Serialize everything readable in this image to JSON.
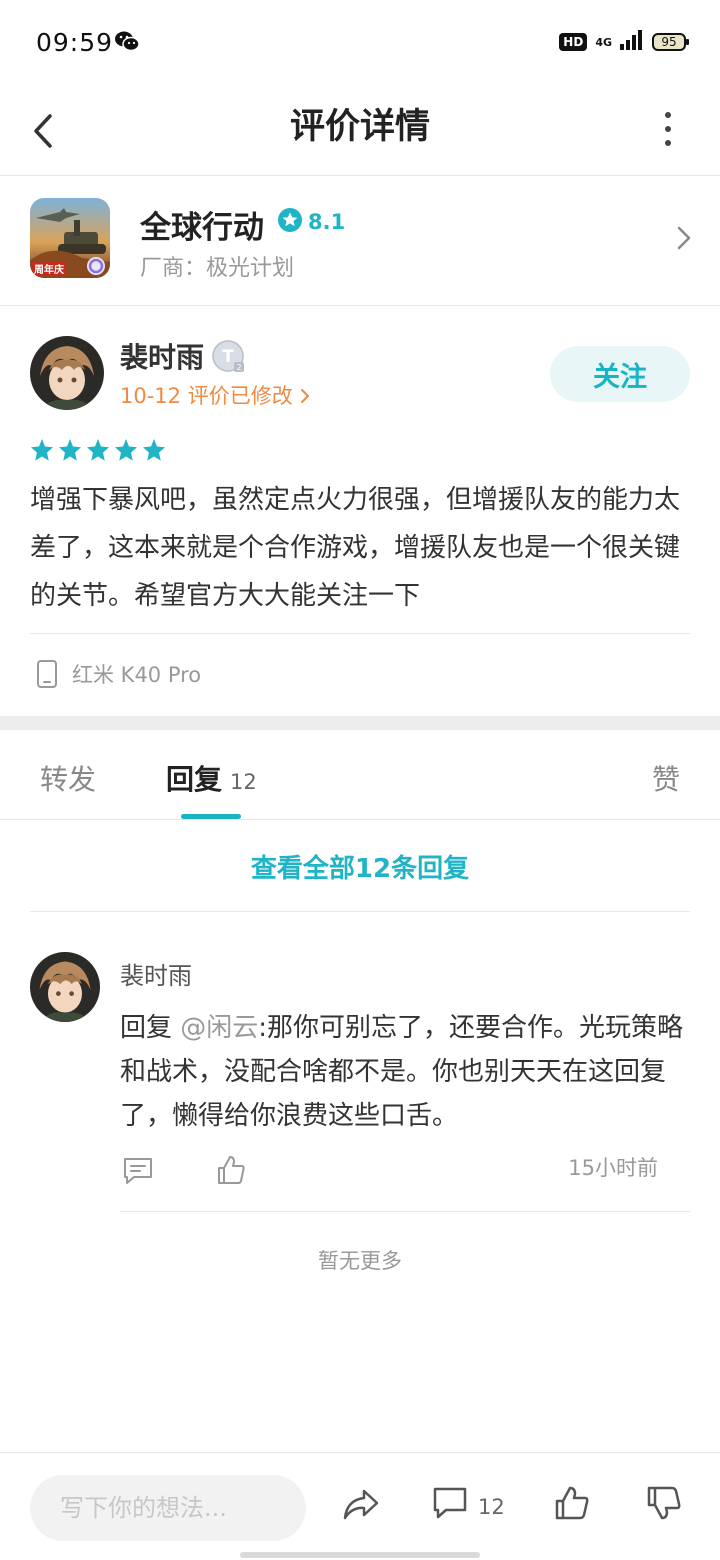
{
  "status_bar": {
    "time": "09:59",
    "hd": "HD",
    "network": "4G",
    "battery": "95"
  },
  "header": {
    "title": "评价详情"
  },
  "game": {
    "name": "全球行动",
    "rating": "8.1",
    "vendor": "厂商：极光计划"
  },
  "review": {
    "author": "裴时雨",
    "meta": "10-12 评价已修改",
    "follow_label": "关注",
    "stars": 5,
    "text": "增强下暴风吧，虽然定点火力很强，但增援队友的能力太差了，这本来就是个合作游戏，增援队友也是一个很关键的关节。希望官方大大能关注一下",
    "device": "红米 K40 Pro"
  },
  "tabs": {
    "repost": "转发",
    "reply": "回复",
    "reply_count": "12",
    "like": "赞"
  },
  "view_all": "查看全部12条回复",
  "reply": {
    "author": "裴时雨",
    "prefix": "回复",
    "mention": "@闲云",
    "text": ":那你可别忘了，还要合作。光玩策略和战术，没配合啥都不是。你也别天天在这回复了，懒得给你浪费这些口舌。",
    "time": "15小时前"
  },
  "no_more": "暂无更多",
  "bottom_bar": {
    "placeholder": "写下你的想法...",
    "comment_count": "12"
  },
  "colors": {
    "accent": "#1fb5c6",
    "meta_orange": "#f08a43"
  }
}
